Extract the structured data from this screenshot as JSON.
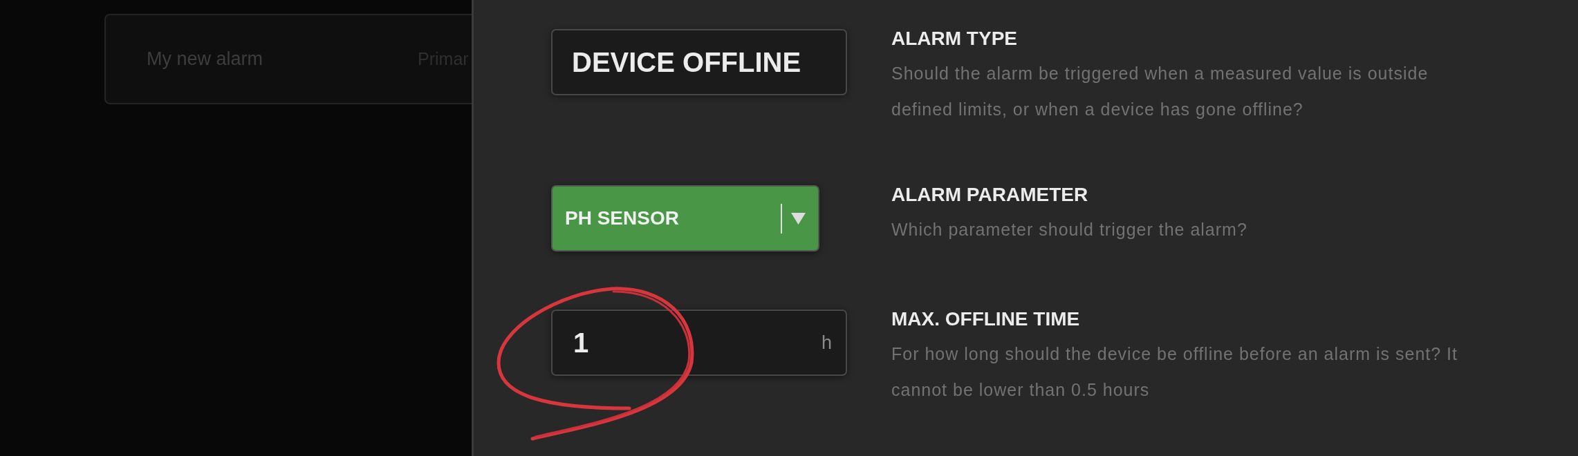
{
  "alarm_list": {
    "card": {
      "name": "My new alarm",
      "column_2": "Primar"
    }
  },
  "settings": [
    {
      "kind": "display",
      "value": "DEVICE OFFLINE",
      "title": "ALARM TYPE",
      "description": "Should the alarm be triggered when a measured value is outside defined limits, or when a device has gone offline?"
    },
    {
      "kind": "dropdown",
      "value": "PH SENSOR",
      "title": "ALARM PARAMETER",
      "description": "Which parameter should trigger the alarm?"
    },
    {
      "kind": "number",
      "value": "1",
      "unit": "h",
      "title": "MAX. OFFLINE TIME",
      "description": "For how long should the device be offline before an alarm is sent? It cannot be lower than 0.5 hours"
    }
  ]
}
